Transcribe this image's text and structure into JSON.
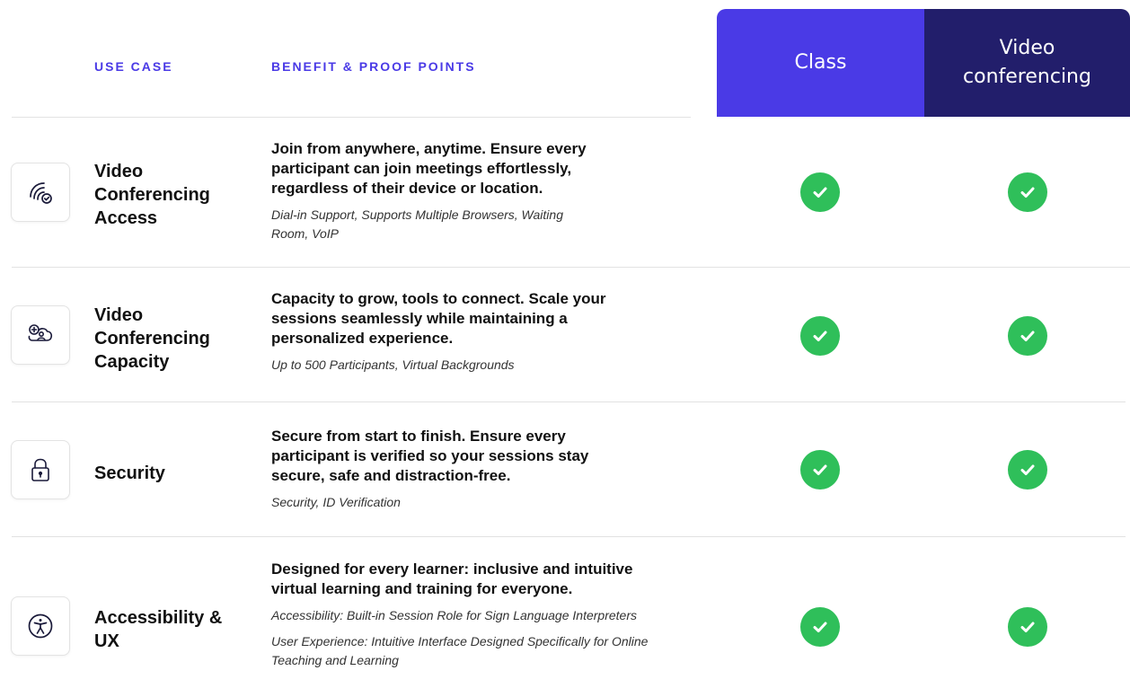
{
  "header": {
    "use_case_label": "USE CASE",
    "benefit_label": "BENEFIT & PROOF POINTS",
    "col_class": "Class",
    "col_video": "Video conferencing"
  },
  "colors": {
    "class_header": "#4a3ae6",
    "video_header": "#221e6b",
    "label_accent": "#4a3ae6",
    "check_green": "#2fbf5a"
  },
  "rows": [
    {
      "icon": "wireless-check-icon",
      "title": "Video Conferencing Access",
      "benefit": "Join from anywhere, anytime. Ensure every participant can join meetings effortlessly, regardless of their device or location.",
      "proofs": [
        "Dial-in Support, Supports Multiple Browsers, Waiting Room, VoIP"
      ],
      "class_included": true,
      "video_included": true
    },
    {
      "icon": "add-user-cloud-icon",
      "title": "Video Conferencing Capacity",
      "benefit": "Capacity to grow, tools to connect. Scale your sessions seamlessly while maintaining a personalized experience.",
      "proofs": [
        "Up to 500 Participants, Virtual Backgrounds"
      ],
      "class_included": true,
      "video_included": true
    },
    {
      "icon": "lock-icon",
      "title": "Security",
      "benefit": "Secure from start to finish. Ensure every participant is verified so your sessions stay secure, safe and distraction-free.",
      "proofs": [
        "Security, ID Verification"
      ],
      "class_included": true,
      "video_included": true
    },
    {
      "icon": "accessibility-icon",
      "title": "Accessibility & UX",
      "benefit": "Designed for every learner: inclusive and intuitive virtual learning and training for everyone.",
      "proofs": [
        "Accessibility: Built-in Session Role for Sign Language Interpreters",
        "User Experience: Intuitive Interface Designed Specifically for Online Teaching and Learning"
      ],
      "class_included": true,
      "video_included": true
    }
  ]
}
